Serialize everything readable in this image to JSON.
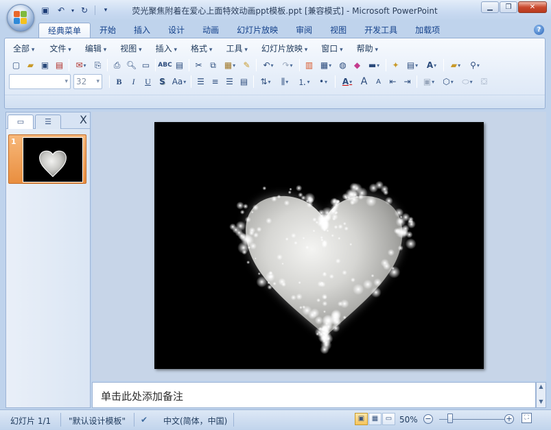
{
  "window": {
    "title": "荧光聚焦附着在爱心上面特效动画ppt模板.ppt [兼容模式] - Microsoft PowerPoint",
    "minimize_icon": "minimize-icon",
    "maximize_icon": "restore-icon",
    "close_icon": "close-icon"
  },
  "qat": {
    "save_icon": "save-icon",
    "undo_icon": "undo-icon",
    "redo_icon": "redo-icon",
    "customize_icon": "customize-qat-icon"
  },
  "tabs": [
    "经典菜单",
    "开始",
    "插入",
    "设计",
    "动画",
    "幻灯片放映",
    "审阅",
    "视图",
    "开发工具",
    "加载项"
  ],
  "active_tab": "经典菜单",
  "menu": [
    "全部",
    "文件",
    "编辑",
    "视图",
    "插入",
    "格式",
    "工具",
    "幻灯片放映",
    "窗口",
    "帮助"
  ],
  "ribbon": {
    "font_name_value": "",
    "font_size_value": "32",
    "bold_label": "B",
    "italic_label": "I",
    "underline_label": "U",
    "shadow_label": "S",
    "change_case_label": "Aa",
    "font_color_label": "A",
    "grow_font_label": "A",
    "shrink_font_label": "A"
  },
  "panel": {
    "close_label": "X",
    "slides": [
      {
        "number": "1"
      }
    ]
  },
  "notes": {
    "placeholder": "单击此处添加备注"
  },
  "status": {
    "slide_info": "幻灯片 1/1",
    "theme": "\"默认设计模板\"",
    "language": "中文(简体，中国)",
    "zoom": "50%"
  },
  "colors": {
    "accent": "#15428b",
    "selection_orange": "#f0a45d",
    "slide_background": "#000000"
  }
}
